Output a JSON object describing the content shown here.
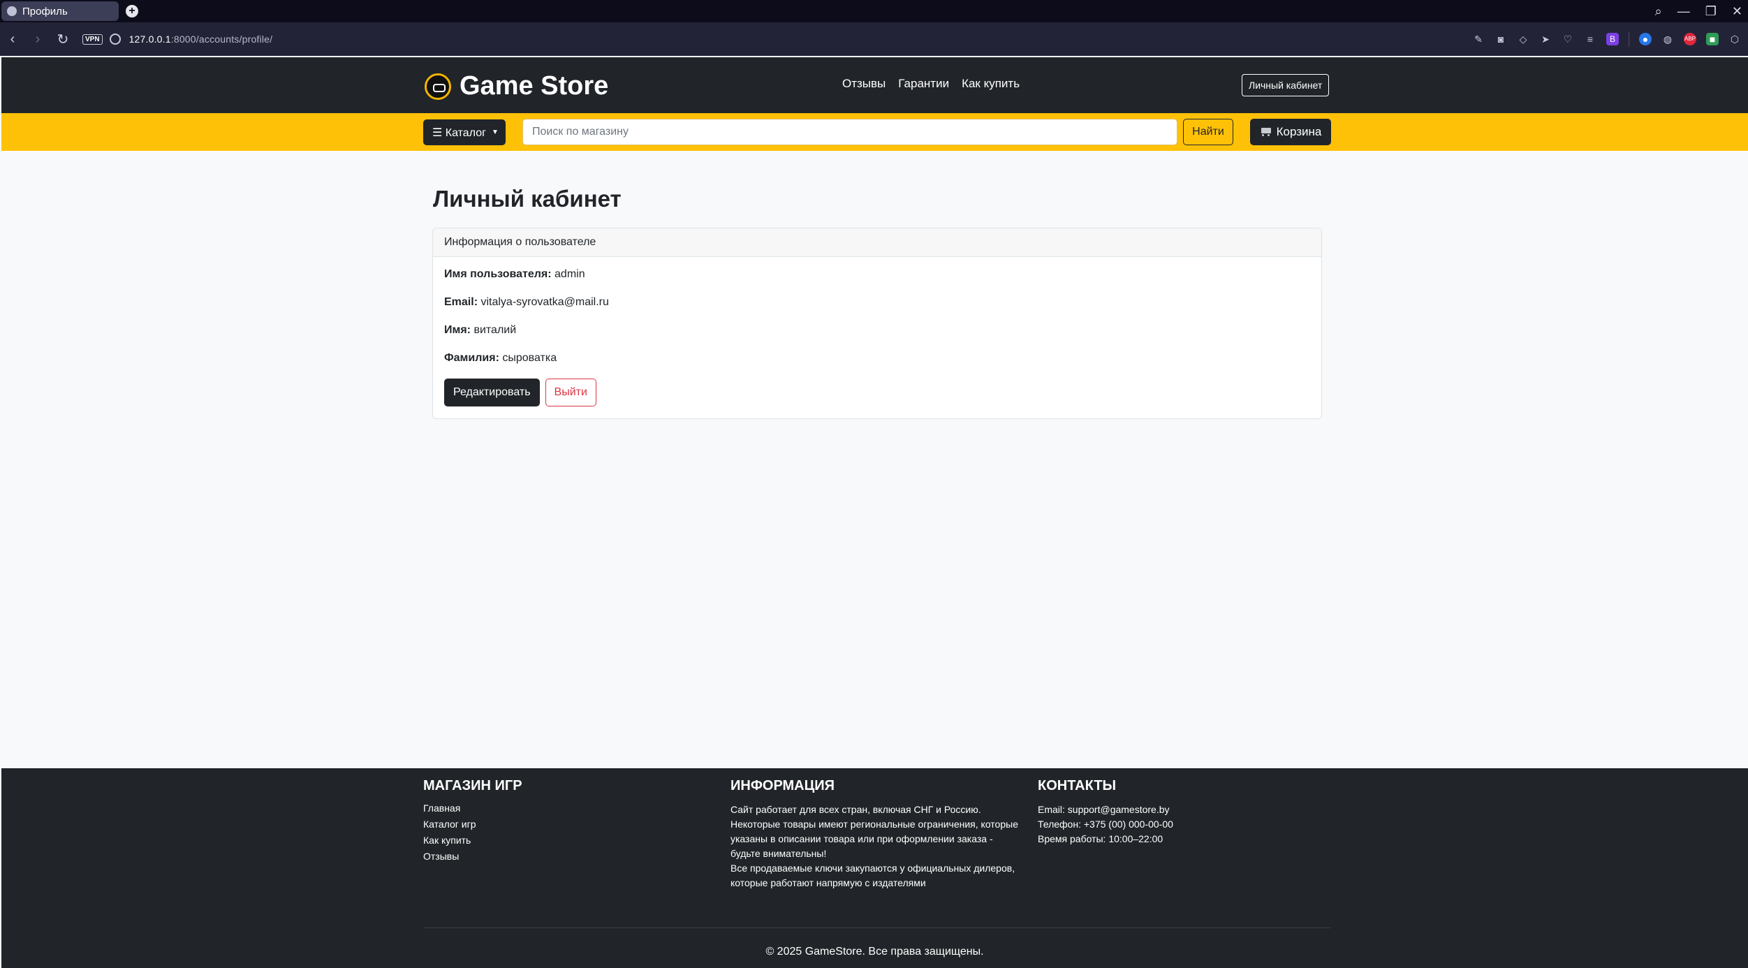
{
  "browser": {
    "tab_title": "Профиль",
    "url_host": "127.0.0.1",
    "url_path": ":8000/accounts/profile/",
    "vpn_label": "VPN",
    "ext_b": "B",
    "ext_abp": "ABP"
  },
  "header": {
    "brand": "Game Store",
    "menu": [
      "Отзывы",
      "Гарантии",
      "Как купить"
    ],
    "account_button": "Личный кабинет"
  },
  "toolbar": {
    "catalog_label": "☰ Каталог",
    "search_placeholder": "Поиск по магазину",
    "search_button": "Найти",
    "cart_label": "Корзина"
  },
  "profile": {
    "title": "Личный кабинет",
    "card_header": "Информация о пользователе",
    "username_label": "Имя пользователя:",
    "username": "admin",
    "email_label": "Email:",
    "email": "vitalya-syrovatka@mail.ru",
    "first_name_label": "Имя:",
    "first_name": "виталий",
    "last_name_label": "Фамилия:",
    "last_name": "сыроватка",
    "edit_button": "Редактировать",
    "logout_button": "Выйти"
  },
  "footer": {
    "shop_title": "МАГАЗИН ИГР",
    "shop_links": [
      "Главная",
      "Каталог игр",
      "Как купить",
      "Отзывы"
    ],
    "info_title": "ИНФОРМАЦИЯ",
    "info_text": [
      "Сайт работает для всех стран, включая СНГ и Россию.",
      "Некоторые товары имеют региональные ограничения, которые",
      "указаны в описании товара или при оформлении заказа -",
      "будьте внимательны!",
      "Все продаваемые ключи закупаются у официальных дилеров,",
      "которые работают напрямую с издателями"
    ],
    "contacts_title": "КОНТАКТЫ",
    "contacts": [
      "Email: support@gamestore.by",
      "Телефон: +375 (00) 000-00-00",
      "Время работы: 10:00–22:00"
    ],
    "copyright": "© 2025 GameStore. Все права защищены."
  },
  "colors": {
    "accent_yellow": "#ffc107",
    "dark": "#212529",
    "danger": "#dc3545"
  }
}
